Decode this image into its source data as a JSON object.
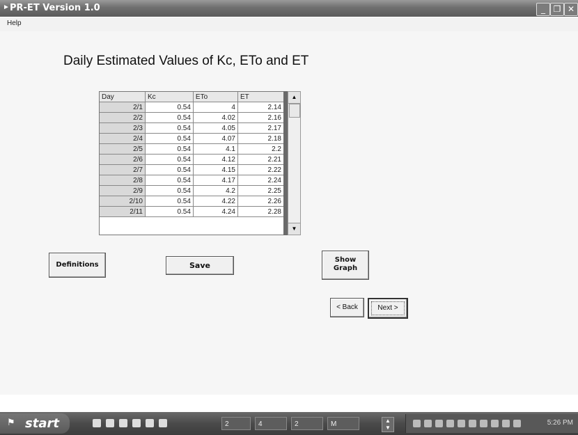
{
  "window": {
    "title": "PR-ET Version 1.0"
  },
  "menu": {
    "help": "Help"
  },
  "heading": "Daily Estimated Values of Kc,  ETo  and ET",
  "table": {
    "columns": [
      "Day",
      "Kc",
      "ETo",
      "ET"
    ],
    "rows": [
      [
        "2/1",
        "0.54",
        "4",
        "2.14"
      ],
      [
        "2/2",
        "0.54",
        "4.02",
        "2.16"
      ],
      [
        "2/3",
        "0.54",
        "4.05",
        "2.17"
      ],
      [
        "2/4",
        "0.54",
        "4.07",
        "2.18"
      ],
      [
        "2/5",
        "0.54",
        "4.1",
        "2.2"
      ],
      [
        "2/6",
        "0.54",
        "4.12",
        "2.21"
      ],
      [
        "2/7",
        "0.54",
        "4.15",
        "2.22"
      ],
      [
        "2/8",
        "0.54",
        "4.17",
        "2.24"
      ],
      [
        "2/9",
        "0.54",
        "4.2",
        "2.25"
      ],
      [
        "2/10",
        "0.54",
        "4.22",
        "2.26"
      ],
      [
        "2/11",
        "0.54",
        "4.24",
        "2.28"
      ]
    ]
  },
  "buttons": {
    "definitions": "Definitions",
    "save": "Save",
    "show_graph_line1": "Show",
    "show_graph_line2": "Graph",
    "back": "< Back",
    "next": "Next >"
  },
  "taskbar": {
    "start": "start",
    "items": [
      "2",
      "4",
      "2",
      "M"
    ],
    "clock": "5:26 PM"
  },
  "icons": {
    "app": "app-icon",
    "minimize": "minimize-icon",
    "maximize": "maximize-icon",
    "close": "close-icon"
  }
}
